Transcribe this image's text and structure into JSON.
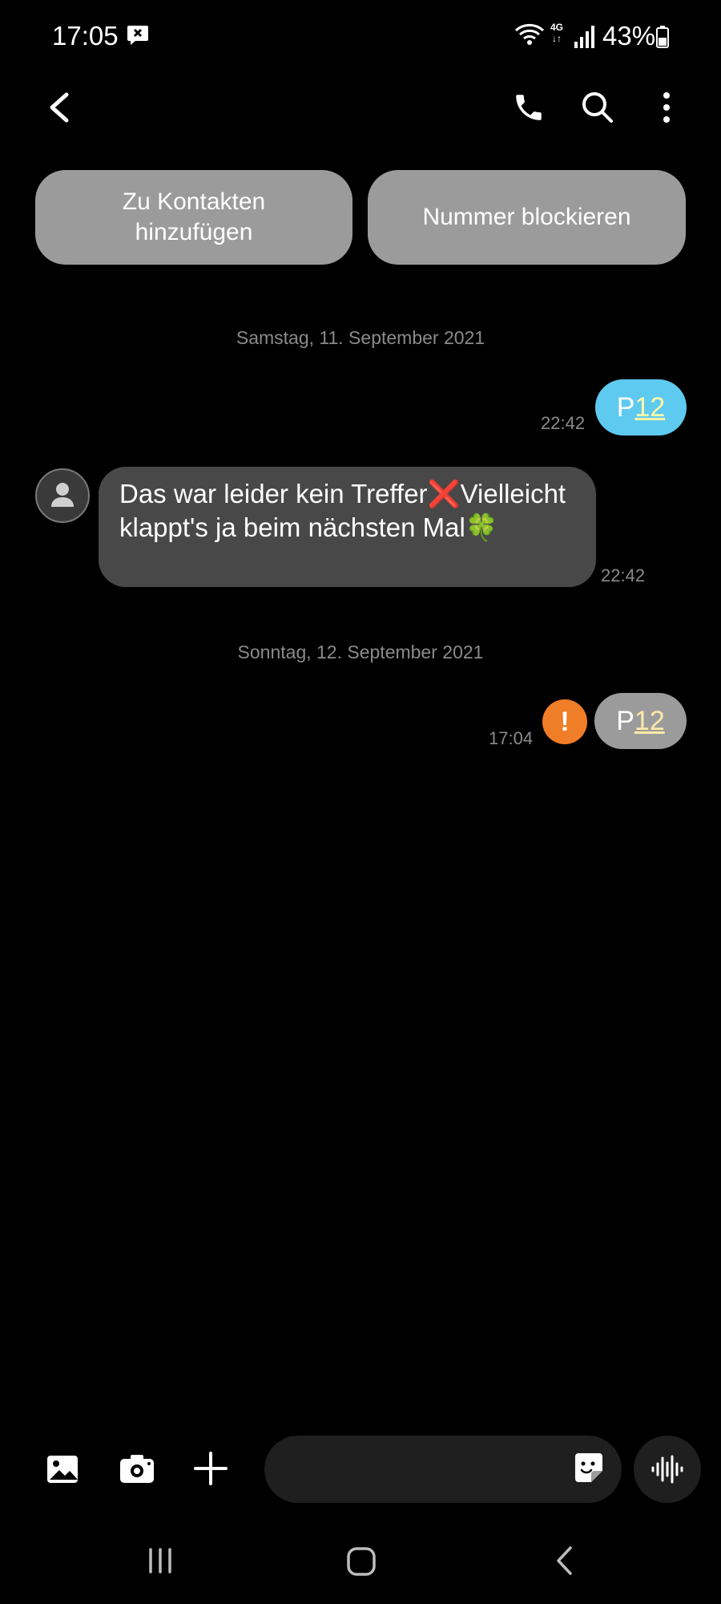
{
  "status_bar": {
    "time": "17:05",
    "battery_percent": "43%",
    "network": "4G",
    "icons": [
      "message-blocked-icon",
      "wifi-icon",
      "4g-icon",
      "signal-icon",
      "battery-icon"
    ]
  },
  "app_bar": {
    "icons": [
      "back-arrow-icon",
      "phone-icon",
      "search-icon",
      "more-vertical-icon"
    ]
  },
  "actions": {
    "add_contact_label": "Zu Kontakten hinzufügen",
    "block_number_label": "Nummer blockieren"
  },
  "conversation": {
    "dates": [
      "Samstag, 11. September 2021",
      "Sonntag, 12. September 2021"
    ],
    "messages": [
      {
        "direction": "outgoing",
        "text_prefix": "P",
        "text_link": "12",
        "time": "22:42",
        "status": "sent"
      },
      {
        "direction": "incoming",
        "text": "Das war leider kein Treffer❌Vielleicht klappt's ja beim nächsten Mal🍀",
        "time": "22:42"
      },
      {
        "direction": "outgoing",
        "text_prefix": "P",
        "text_link": "12",
        "time": "17:04",
        "status": "failed",
        "error_symbol": "!"
      }
    ]
  },
  "composer": {
    "icons": [
      "gallery-icon",
      "camera-icon",
      "plus-icon",
      "sticker-icon",
      "voice-waveform-icon"
    ]
  },
  "colors": {
    "background": "#000000",
    "outgoing_bubble": "#5ecaf0",
    "failed_bubble": "#9b9b9b",
    "incoming_bubble": "#484848",
    "error_badge": "#f07d27"
  }
}
